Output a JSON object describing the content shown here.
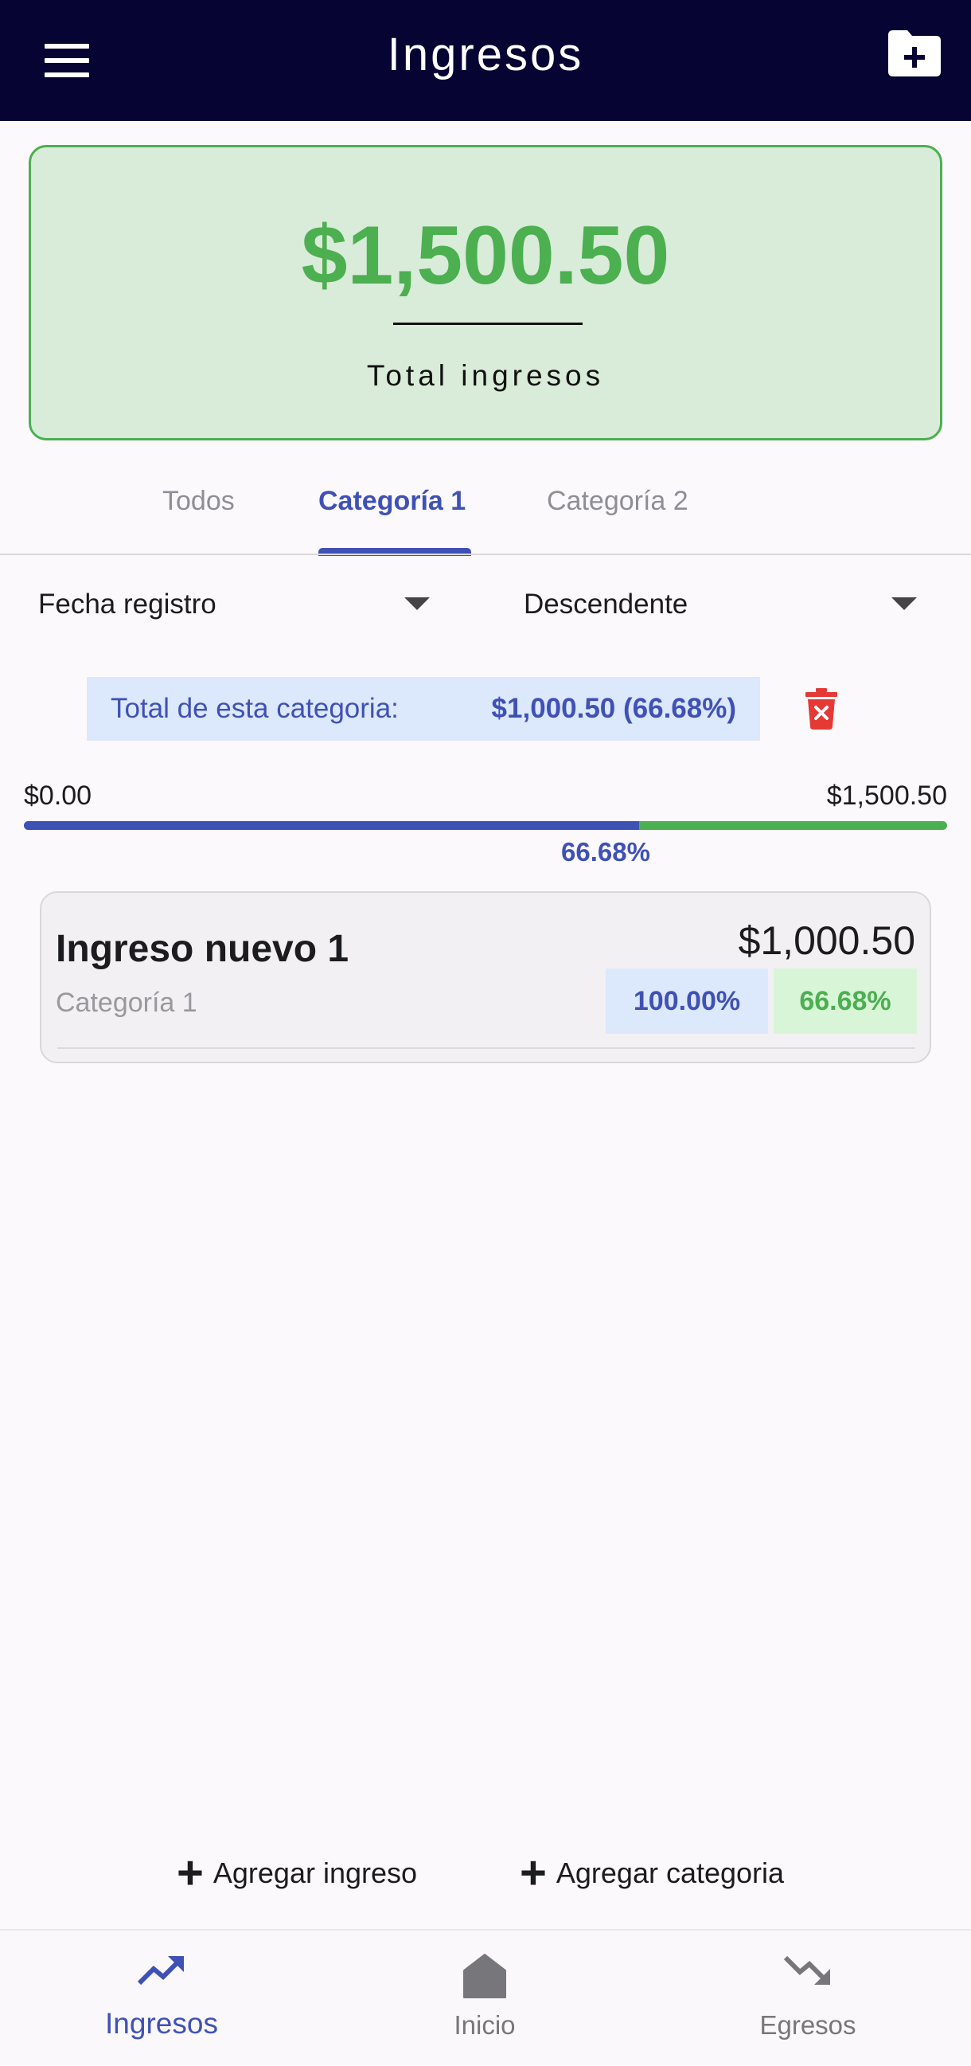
{
  "app_bar": {
    "title": "Ingresos",
    "menu_icon": "hamburger-menu-icon",
    "action_icon": "folder-add-icon"
  },
  "summary": {
    "amount": "$1,500.50",
    "label": "Total ingresos"
  },
  "tabs": [
    {
      "label": "Todos",
      "active": false
    },
    {
      "label": "Categoría 1",
      "active": true
    },
    {
      "label": "Categoría 2",
      "active": false
    }
  ],
  "filters": {
    "sort_field": "Fecha registro",
    "sort_order": "Descendente"
  },
  "category_total": {
    "label": "Total de esta categoria:",
    "value": "$1,000.50 (66.68%)",
    "delete_icon": "trash-icon"
  },
  "progress": {
    "min": "$0.00",
    "max": "$1,500.50",
    "percent_label": "66.68%",
    "fraction": 0.6668
  },
  "items": [
    {
      "title": "Ingreso nuevo 1",
      "category": "Categoría 1",
      "amount": "$1,000.50",
      "category_percent": "100.00%",
      "total_percent": "66.68%"
    }
  ],
  "actions": {
    "add_income": "Agregar ingreso",
    "add_category": "Agregar categoria"
  },
  "bottom_nav": [
    {
      "label": "Ingresos",
      "icon": "trending-up-icon",
      "active": true
    },
    {
      "label": "Inicio",
      "icon": "home-icon",
      "active": false
    },
    {
      "label": "Egresos",
      "icon": "trending-down-icon",
      "active": false
    }
  ],
  "colors": {
    "app_bar": "#050432",
    "accent": "#3f51b5",
    "income_green": "#4caf50",
    "delete_red": "#e53935"
  }
}
